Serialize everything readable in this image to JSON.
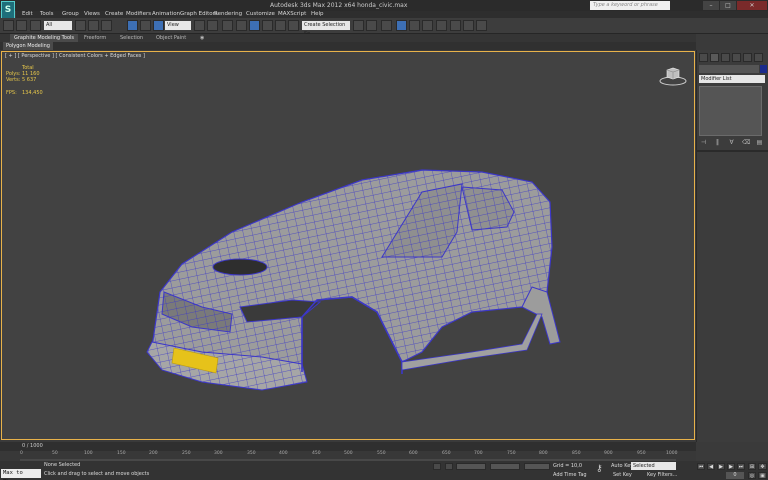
{
  "window": {
    "title": "Autodesk 3ds Max 2012 x64     honda_civic.max",
    "search_placeholder": "Type a keyword or phrase",
    "minimize": "–",
    "maximize": "□",
    "close": "✕"
  },
  "menu": [
    "Edit",
    "Tools",
    "Group",
    "Views",
    "Create",
    "Modifiers",
    "Animation",
    "Graph Editors",
    "Rendering",
    "Customize",
    "MAXScript",
    "Help"
  ],
  "toolbar": {
    "selection_filter": "All",
    "coord_system": "View",
    "named_selection": "Create Selection Se"
  },
  "ribbon": {
    "tabs": [
      "Graphite Modeling Tools",
      "Freeform",
      "Selection",
      "Object Paint"
    ],
    "panel_label": "Polygon Modeling"
  },
  "viewport": {
    "label": "[ + ] [ Perspective ] [ Consistent Colors + Edged Faces ]",
    "stats": {
      "total_label": "Total",
      "polys_label": "Polys:",
      "polys_value": "11 160",
      "verts_label": "Verts:",
      "verts_value": "5 637",
      "fps_label": "FPS:",
      "fps_value": "134,450"
    }
  },
  "command_panel": {
    "modifier_list": "Modifier List"
  },
  "timeline": {
    "frame_label": "0 / 1000",
    "ticks": [
      "0",
      "50",
      "100",
      "150",
      "200",
      "250",
      "300",
      "350",
      "400",
      "450",
      "500",
      "550",
      "600",
      "650",
      "700",
      "750",
      "800",
      "850",
      "900",
      "950",
      "1000"
    ]
  },
  "status": {
    "maxscript": "Max to Physc",
    "selection": "None Selected",
    "hint": "Click and drag to select and move objects",
    "grid": "Grid = 10,0",
    "add_time_tag": "Add Time Tag",
    "auto_key": "Auto Key",
    "set_key": "Set Key",
    "selected_dropdown": "Selected",
    "key_filters": "Key Filters...",
    "frame": "0"
  },
  "colors": {
    "viewport_bg": "#424242",
    "viewport_border": "#e8b24a",
    "wire": "#3c37c8",
    "car_body": "#9a9a9a",
    "plate": "#e6c21a"
  }
}
